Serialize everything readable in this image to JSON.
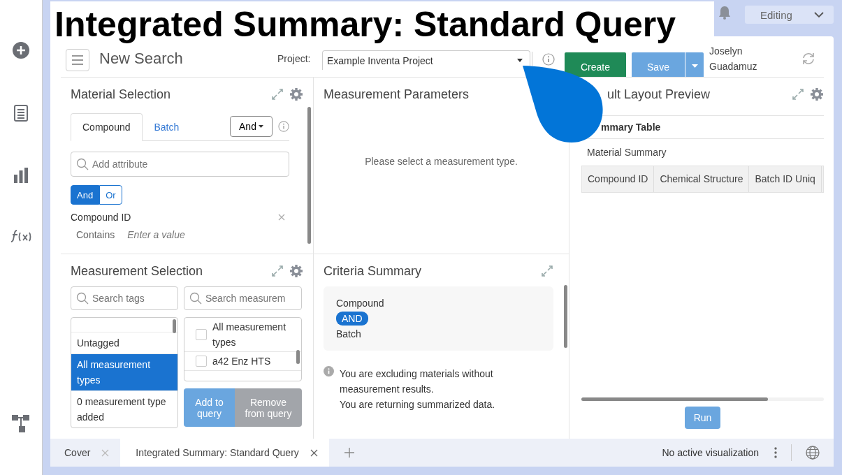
{
  "overlay_title": "Integrated Summary: Standard Query",
  "top_bar": {
    "mode": "Editing"
  },
  "header": {
    "title": "New Search",
    "project_label": "Project:",
    "project": "Example Inventa Project",
    "create": "Create",
    "save": "Save",
    "user": [
      "Joselyn",
      "Guadamuz"
    ]
  },
  "material_selection": {
    "title": "Material Selection",
    "tabs": [
      {
        "label": "Compound",
        "selected": true
      },
      {
        "label": "Batch",
        "selected": false
      }
    ],
    "operator": "And",
    "search": {
      "placeholder": "Add attribute"
    },
    "toggle": [
      {
        "label": "And",
        "selected": true
      },
      {
        "label": "Or",
        "selected": false
      }
    ],
    "criterion": {
      "name": "Compound ID",
      "condition": "Contains",
      "placeholder": "Enter a value"
    }
  },
  "measurement_parameters": {
    "title": "Measurement Parameters",
    "message": "Please select a measurement type."
  },
  "result_preview": {
    "title": "ult Layout Preview",
    "table_title": "mmary Table",
    "section": "Material Summary",
    "columns": [
      "Compound ID",
      "Chemical Structure",
      "Batch ID Uniq"
    ],
    "run": "Run"
  },
  "measurement_selection": {
    "title": "Measurement Selection",
    "tag_search": {
      "placeholder": "Search tags"
    },
    "measurement_search": {
      "placeholder": "Search measurem"
    },
    "tag_menu": [
      {
        "label": "Untagged",
        "selected": false
      },
      {
        "label": "All measurement types",
        "selected": true
      },
      {
        "label": "0 measurement type added",
        "selected": false
      }
    ],
    "measurements": [
      {
        "label": "All measurement types",
        "checked": false
      },
      {
        "label": "a42 Enz HTS",
        "checked": false
      }
    ],
    "add": "Add to query",
    "remove": "Remove from query"
  },
  "criteria_summary": {
    "title": "Criteria Summary",
    "items": [
      "Compound",
      "AND",
      "Batch"
    ],
    "notes": [
      "You are excluding materials without measurement results.",
      "You are returning summarized data."
    ]
  },
  "bottom_tabs": [
    {
      "label": "Cover",
      "selected": false
    },
    {
      "label": "Integrated Summary: Standard Query",
      "selected": true
    }
  ],
  "status": "No active visualization"
}
